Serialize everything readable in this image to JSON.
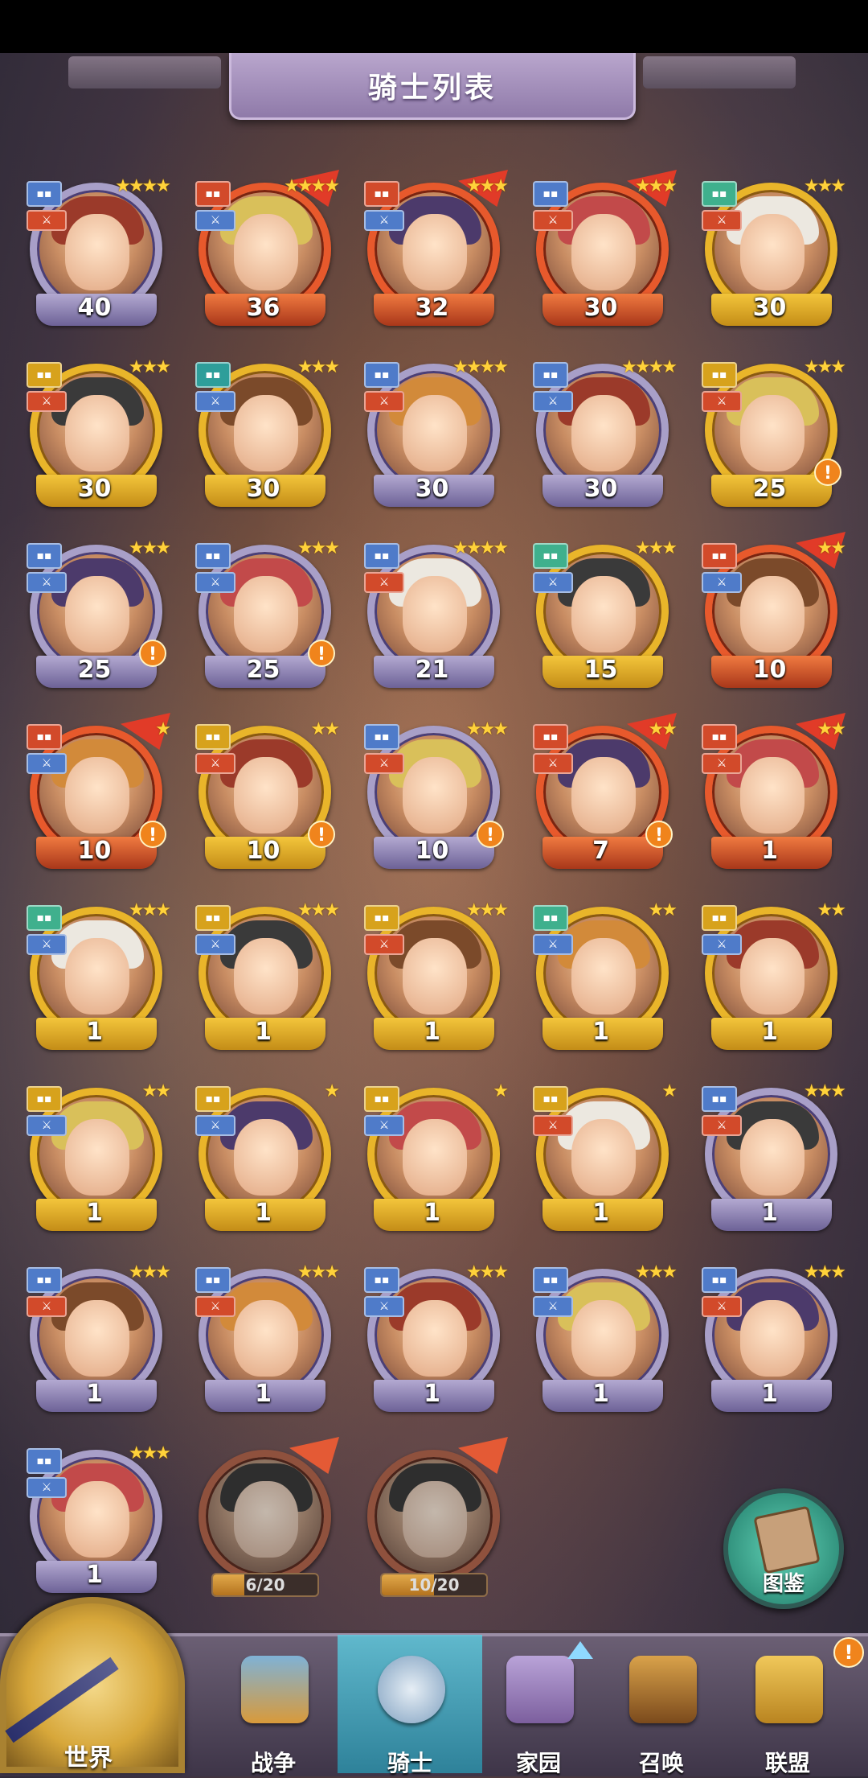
{
  "title": "骑士列表",
  "knights": [
    {
      "level": "40",
      "stars": "★★★★",
      "frame": "purple",
      "flag": false,
      "alert": false,
      "class_badge": "blue",
      "role_badge": "red"
    },
    {
      "level": "36",
      "stars": "★★★★",
      "frame": "red",
      "flag": true,
      "alert": false,
      "class_badge": "red",
      "role_badge": "blue"
    },
    {
      "level": "32",
      "stars": "★★★",
      "frame": "red",
      "flag": true,
      "alert": false,
      "class_badge": "red",
      "role_badge": "blue"
    },
    {
      "level": "30",
      "stars": "★★★",
      "frame": "red",
      "flag": true,
      "alert": false,
      "class_badge": "blue",
      "role_badge": "red"
    },
    {
      "level": "30",
      "stars": "★★★",
      "frame": "gold",
      "flag": false,
      "alert": false,
      "class_badge": "green",
      "role_badge": "red"
    },
    {
      "level": "30",
      "stars": "★★★",
      "frame": "gold",
      "flag": false,
      "alert": false,
      "class_badge": "gold",
      "role_badge": "red"
    },
    {
      "level": "30",
      "stars": "★★★",
      "frame": "gold",
      "flag": false,
      "alert": false,
      "class_badge": "teal",
      "role_badge": "blue"
    },
    {
      "level": "30",
      "stars": "★★★★",
      "frame": "purple",
      "flag": false,
      "alert": false,
      "class_badge": "blue",
      "role_badge": "red"
    },
    {
      "level": "30",
      "stars": "★★★★",
      "frame": "purple",
      "flag": false,
      "alert": false,
      "class_badge": "blue",
      "role_badge": "blue"
    },
    {
      "level": "25",
      "stars": "★★★",
      "frame": "gold",
      "flag": false,
      "alert": true,
      "class_badge": "gold",
      "role_badge": "red"
    },
    {
      "level": "25",
      "stars": "★★★",
      "frame": "purple",
      "flag": false,
      "alert": true,
      "class_badge": "blue",
      "role_badge": "blue"
    },
    {
      "level": "25",
      "stars": "★★★",
      "frame": "purple",
      "flag": false,
      "alert": true,
      "class_badge": "blue",
      "role_badge": "blue"
    },
    {
      "level": "21",
      "stars": "★★★★",
      "frame": "purple",
      "flag": false,
      "alert": false,
      "class_badge": "blue",
      "role_badge": "red"
    },
    {
      "level": "15",
      "stars": "★★★",
      "frame": "gold",
      "flag": false,
      "alert": false,
      "class_badge": "green",
      "role_badge": "blue"
    },
    {
      "level": "10",
      "stars": "★★",
      "frame": "red",
      "flag": true,
      "alert": false,
      "class_badge": "red",
      "role_badge": "blue"
    },
    {
      "level": "10",
      "stars": "★",
      "frame": "red",
      "flag": true,
      "alert": true,
      "class_badge": "red",
      "role_badge": "blue"
    },
    {
      "level": "10",
      "stars": "★★",
      "frame": "gold",
      "flag": false,
      "alert": true,
      "class_badge": "gold",
      "role_badge": "red"
    },
    {
      "level": "10",
      "stars": "★★★",
      "frame": "purple",
      "flag": false,
      "alert": true,
      "class_badge": "blue",
      "role_badge": "red"
    },
    {
      "level": "7",
      "stars": "★★",
      "frame": "red",
      "flag": true,
      "alert": true,
      "class_badge": "red",
      "role_badge": "red"
    },
    {
      "level": "1",
      "stars": "★★",
      "frame": "red",
      "flag": true,
      "alert": false,
      "class_badge": "red",
      "role_badge": "red"
    },
    {
      "level": "1",
      "stars": "★★★",
      "frame": "gold",
      "flag": false,
      "alert": false,
      "class_badge": "green",
      "role_badge": "blue"
    },
    {
      "level": "1",
      "stars": "★★★",
      "frame": "gold",
      "flag": false,
      "alert": false,
      "class_badge": "gold",
      "role_badge": "blue"
    },
    {
      "level": "1",
      "stars": "★★★",
      "frame": "gold",
      "flag": false,
      "alert": false,
      "class_badge": "gold",
      "role_badge": "red"
    },
    {
      "level": "1",
      "stars": "★★",
      "frame": "gold",
      "flag": false,
      "alert": false,
      "class_badge": "green",
      "role_badge": "blue"
    },
    {
      "level": "1",
      "stars": "★★",
      "frame": "gold",
      "flag": false,
      "alert": false,
      "class_badge": "gold",
      "role_badge": "blue"
    },
    {
      "level": "1",
      "stars": "★★",
      "frame": "gold",
      "flag": false,
      "alert": false,
      "class_badge": "gold",
      "role_badge": "blue"
    },
    {
      "level": "1",
      "stars": "★",
      "frame": "gold",
      "flag": false,
      "alert": false,
      "class_badge": "gold",
      "role_badge": "blue"
    },
    {
      "level": "1",
      "stars": "★",
      "frame": "gold",
      "flag": false,
      "alert": false,
      "class_badge": "gold",
      "role_badge": "blue"
    },
    {
      "level": "1",
      "stars": "★",
      "frame": "gold",
      "flag": false,
      "alert": false,
      "class_badge": "gold",
      "role_badge": "red"
    },
    {
      "level": "1",
      "stars": "★★★",
      "frame": "purple",
      "flag": false,
      "alert": false,
      "class_badge": "blue",
      "role_badge": "red"
    },
    {
      "level": "1",
      "stars": "★★★",
      "frame": "purple",
      "flag": false,
      "alert": false,
      "class_badge": "blue",
      "role_badge": "red"
    },
    {
      "level": "1",
      "stars": "★★★",
      "frame": "purple",
      "flag": false,
      "alert": false,
      "class_badge": "blue",
      "role_badge": "red"
    },
    {
      "level": "1",
      "stars": "★★★",
      "frame": "purple",
      "flag": false,
      "alert": false,
      "class_badge": "blue",
      "role_badge": "blue"
    },
    {
      "level": "1",
      "stars": "★★★",
      "frame": "purple",
      "flag": false,
      "alert": false,
      "class_badge": "blue",
      "role_badge": "blue"
    },
    {
      "level": "1",
      "stars": "★★★",
      "frame": "purple",
      "flag": false,
      "alert": false,
      "class_badge": "blue",
      "role_badge": "red"
    },
    {
      "level": "1",
      "stars": "★★★",
      "frame": "purple",
      "flag": false,
      "alert": false,
      "class_badge": "blue",
      "role_badge": "blue"
    }
  ],
  "locked_knights": [
    {
      "progress": "6/20",
      "fraction": 0.3
    },
    {
      "progress": "10/20",
      "fraction": 0.5
    }
  ],
  "codex_label": "图鉴",
  "nav": {
    "world": "世界",
    "war": "战争",
    "knight": "骑士",
    "home": "家园",
    "summon": "召唤",
    "alliance": "联盟",
    "alert": "!"
  },
  "colors": {
    "gold_frame": "#e9b52a",
    "purple_frame": "#a89fc8",
    "red_frame": "#e7592c",
    "alert": "#f0841c",
    "active_tab": "#5ec8dc"
  }
}
